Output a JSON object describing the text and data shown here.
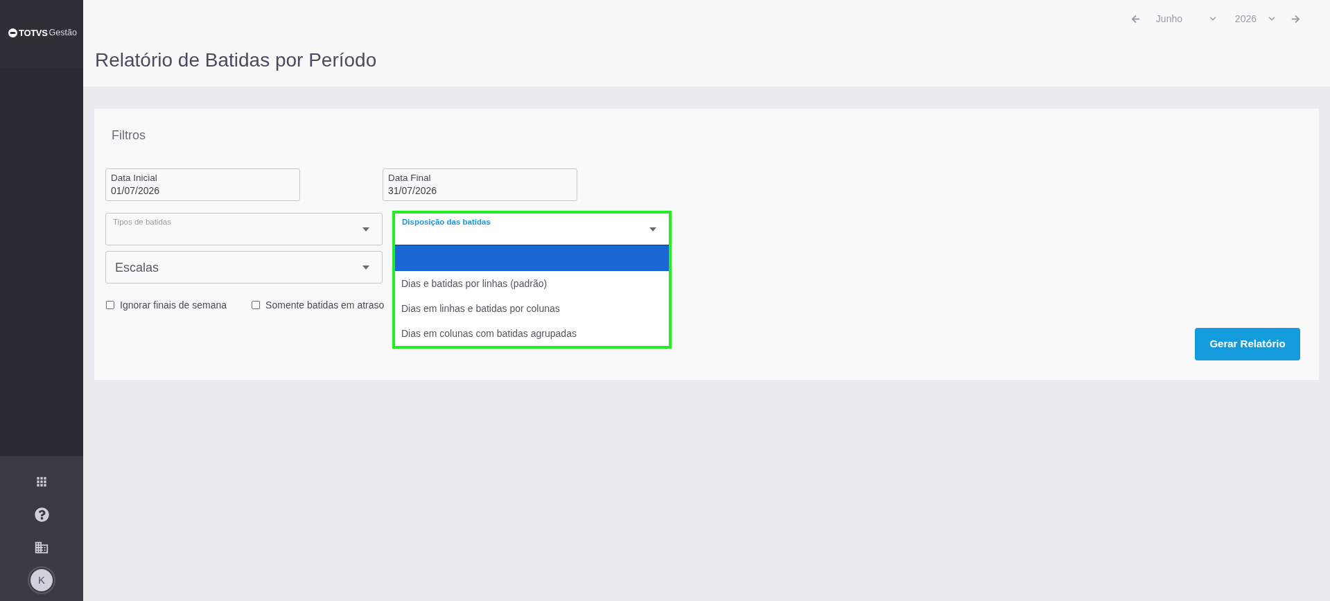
{
  "sidebar": {
    "logo": {
      "brand": "TOTVS",
      "product": "Gestão"
    },
    "avatar": {
      "initial": "K"
    }
  },
  "header": {
    "title": "Relatório de Batidas por Período",
    "period": {
      "month": "Junho",
      "year": "2026"
    }
  },
  "filters": {
    "title": "Filtros",
    "field_rows": [
      [
        {
          "kind": "date",
          "label": "Data Inicial",
          "value": "01/07/2026"
        },
        {
          "kind": "date",
          "label": "Data Final",
          "value": "31/07/2026"
        }
      ],
      [
        {
          "kind": "select",
          "label": "Tipos de batidas",
          "focused": false,
          "expanded": false
        },
        {
          "kind": "select",
          "label": "Disposição das batidas",
          "focused": true,
          "expanded": true,
          "highlighted": true,
          "options": [
            {
              "selected": true
            },
            {
              "label": "Dias e batidas por linhas (padrão)",
              "selected": false
            },
            {
              "label": "Dias em linhas e batidas por colunas",
              "selected": false
            },
            {
              "label": "Dias em colunas com batidas agrupadas",
              "selected": false
            }
          ]
        }
      ],
      [
        {
          "kind": "select",
          "placeholder": "Escalas",
          "focused": false,
          "expanded": false
        }
      ]
    ],
    "checkboxes": [
      {
        "label": "Ignorar finais de semana",
        "checked": false
      },
      {
        "label": "Somente batidas em atraso",
        "checked": false
      }
    ],
    "button": "Gerar Relatório"
  }
}
